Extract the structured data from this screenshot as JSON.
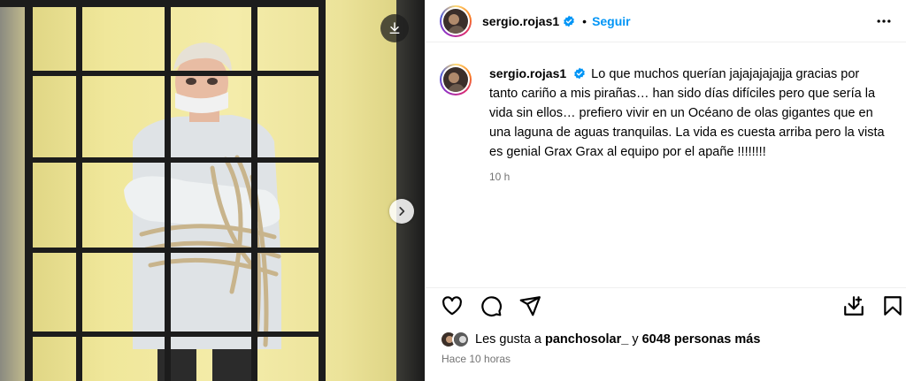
{
  "post": {
    "username": "sergio.rojas1",
    "follow_label": "Seguir",
    "separator": "•",
    "caption": "Lo que muchos querían jajajajajajja gracias por tanto cariño a mis pirañas… han sido días difíciles pero que sería la vida sin ellos… prefiero vivir en un Océano de olas gigantes que en una laguna de aguas tranquilas. La vida es cuesta arriba pero la vista es genial Grax Grax al equipo por el apañe !!!!!!!!",
    "relative_time": "10 h",
    "likes_prefix": "Les gusta a",
    "likes_user": "panchosolar_",
    "likes_join": "y",
    "likes_count": "6048 personas más",
    "date_label": "Hace 10 horas"
  },
  "icons": {
    "download": "download-icon",
    "next": "chevron-right-icon",
    "more": "more-options-icon",
    "verified": "verified-badge-icon",
    "like": "heart-icon",
    "comment": "comment-icon",
    "share": "share-icon",
    "save_download": "save-download-icon",
    "bookmark": "bookmark-icon"
  },
  "colors": {
    "follow": "#0095f6",
    "secondary_text": "#737373",
    "verified": "#0095f6"
  }
}
